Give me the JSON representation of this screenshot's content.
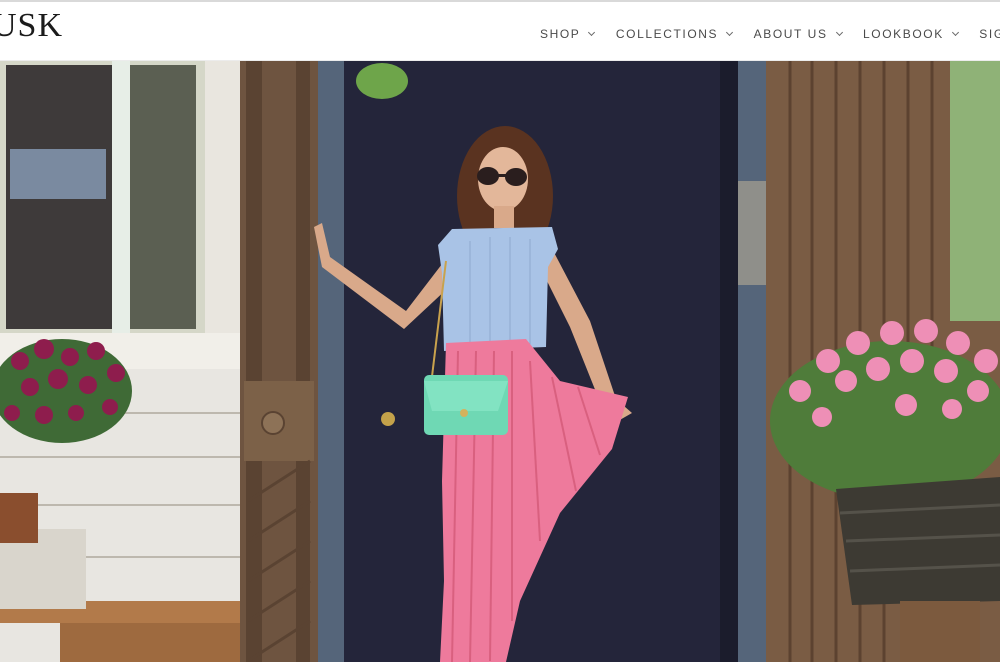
{
  "brand": {
    "logo_text": "USK"
  },
  "nav": {
    "items": [
      {
        "label": "SHOP",
        "icon": "chevron-down-icon"
      },
      {
        "label": "COLLECTIONS",
        "icon": "chevron-down-icon"
      },
      {
        "label": "ABOUT US",
        "icon": "chevron-down-icon"
      },
      {
        "label": "LOOKBOOK",
        "icon": "chevron-down-icon"
      },
      {
        "label": "SIGN IN"
      }
    ]
  },
  "colors": {
    "header_bg": "#ffffff",
    "nav_text": "#4a4a4a",
    "door": "#24253a",
    "skirt": "#ee7a9c",
    "shirt": "#a9c3e6",
    "bag": "#6fd8b4"
  }
}
